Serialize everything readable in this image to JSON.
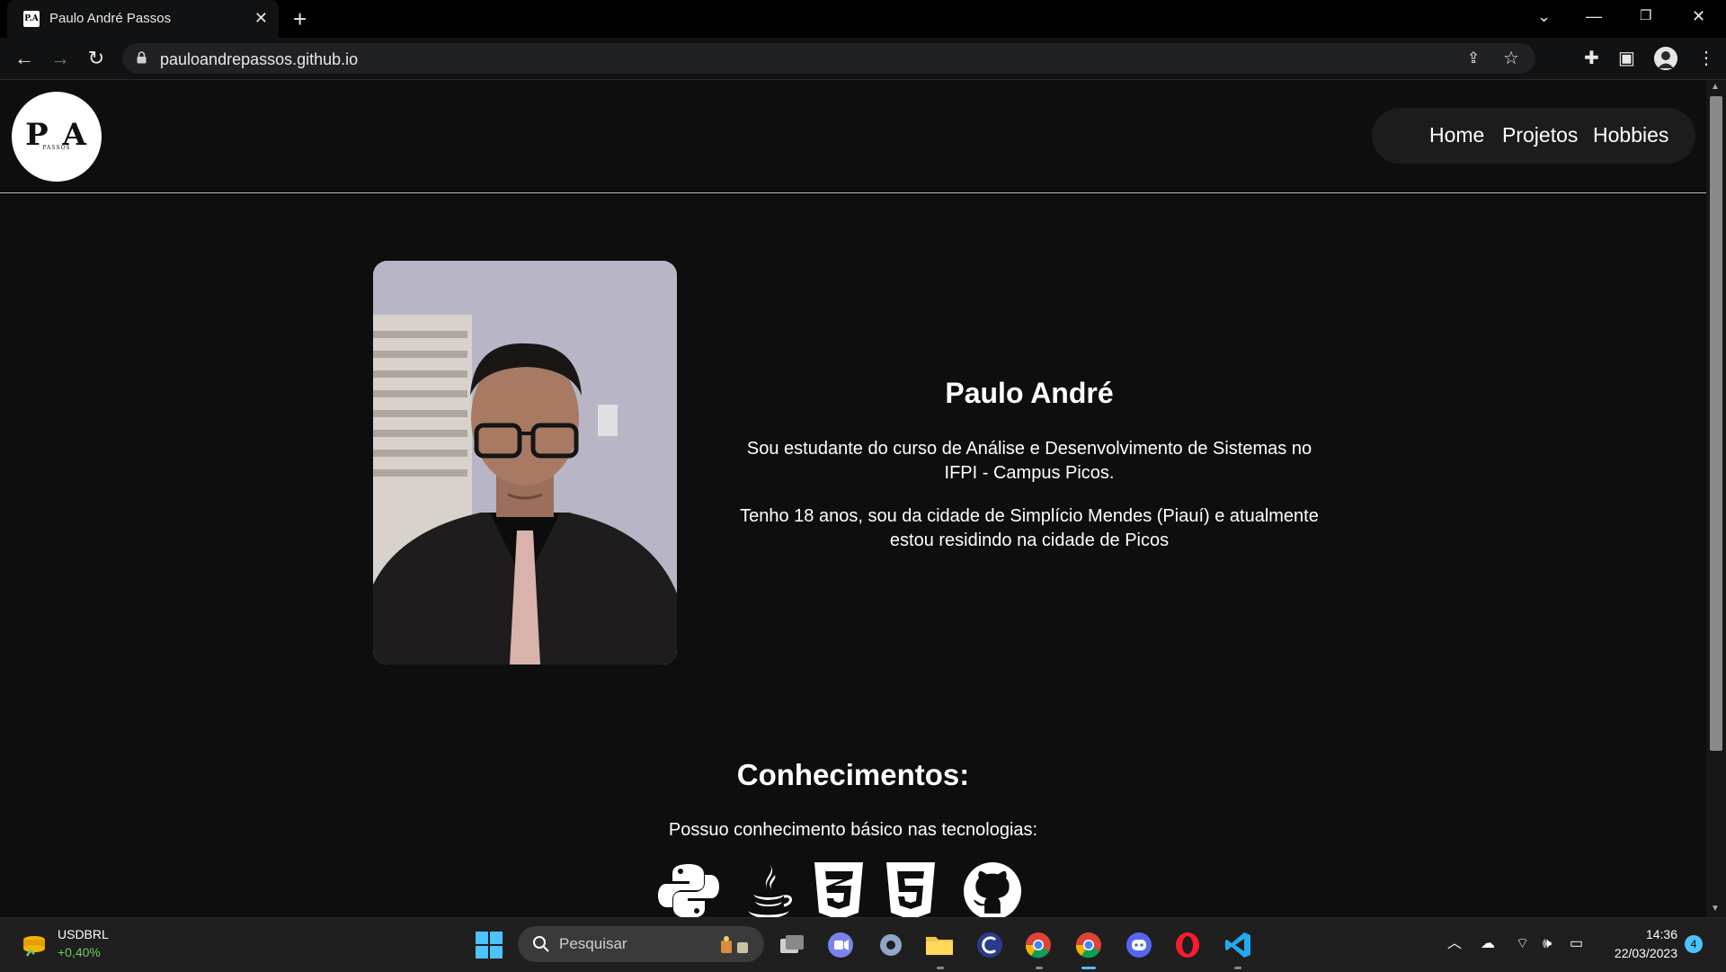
{
  "browser": {
    "tab_title": "Paulo André Passos",
    "favicon_text": "P.A",
    "url": "pauloandrepassos.github.io"
  },
  "site": {
    "logo_letters": "P A",
    "logo_sub": "PASSOS",
    "nav": [
      "Home",
      "Projetos",
      "Hobbies"
    ],
    "intro": {
      "name": "Paulo André",
      "paragraph1": "Sou estudante do curso de Análise e Desenvolvimento de Sistemas no IFPI - Campus Picos.",
      "paragraph2": "Tenho 18 anos, sou da cidade de Simplício Mendes (Piauí) e atualmente estou residindo na cidade de Picos"
    },
    "skills": {
      "heading": "Conhecimentos:",
      "description": "Possuo conhecimento básico nas tecnologias:",
      "icons": [
        "python-icon",
        "java-icon",
        "css3-icon",
        "html5-icon",
        "github-icon"
      ]
    }
  },
  "taskbar": {
    "widget_ticker": "USDBRL",
    "widget_change": "+0,40%",
    "search_placeholder": "Pesquisar",
    "time": "14:36",
    "date": "22/03/2023",
    "notification_count": "4"
  },
  "colors": {
    "page_bg": "#0e0e0e",
    "nav_pill": "#1c1c1c",
    "accent_green": "#6ccb5f",
    "badge_blue": "#4cc2ff"
  }
}
